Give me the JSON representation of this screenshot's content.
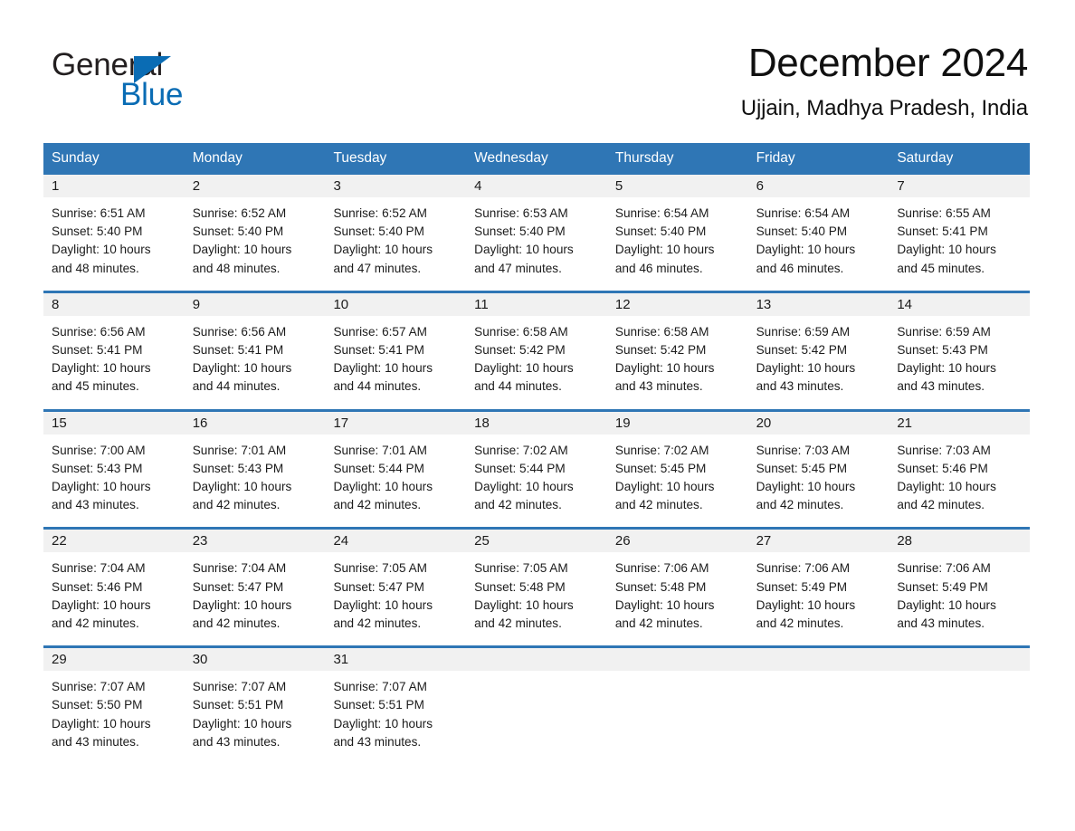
{
  "brand": {
    "word_one": "General",
    "word_two": "Blue",
    "triangle_color": "#0a6cb4"
  },
  "header": {
    "month_title": "December 2024",
    "location_title": "Ujjain, Madhya Pradesh, India"
  },
  "colors": {
    "header_blue": "#2f76b5",
    "day_band_gray": "#f1f1f1",
    "text": "#1b1b1b",
    "page_background": "#ffffff"
  },
  "calendar": {
    "weekdays": [
      "Sunday",
      "Monday",
      "Tuesday",
      "Wednesday",
      "Thursday",
      "Friday",
      "Saturday"
    ],
    "weeks": [
      [
        {
          "day": "1",
          "sunrise": "Sunrise: 6:51 AM",
          "sunset": "Sunset: 5:40 PM",
          "daylight_l1": "Daylight: 10 hours",
          "daylight_l2": "and 48 minutes."
        },
        {
          "day": "2",
          "sunrise": "Sunrise: 6:52 AM",
          "sunset": "Sunset: 5:40 PM",
          "daylight_l1": "Daylight: 10 hours",
          "daylight_l2": "and 48 minutes."
        },
        {
          "day": "3",
          "sunrise": "Sunrise: 6:52 AM",
          "sunset": "Sunset: 5:40 PM",
          "daylight_l1": "Daylight: 10 hours",
          "daylight_l2": "and 47 minutes."
        },
        {
          "day": "4",
          "sunrise": "Sunrise: 6:53 AM",
          "sunset": "Sunset: 5:40 PM",
          "daylight_l1": "Daylight: 10 hours",
          "daylight_l2": "and 47 minutes."
        },
        {
          "day": "5",
          "sunrise": "Sunrise: 6:54 AM",
          "sunset": "Sunset: 5:40 PM",
          "daylight_l1": "Daylight: 10 hours",
          "daylight_l2": "and 46 minutes."
        },
        {
          "day": "6",
          "sunrise": "Sunrise: 6:54 AM",
          "sunset": "Sunset: 5:40 PM",
          "daylight_l1": "Daylight: 10 hours",
          "daylight_l2": "and 46 minutes."
        },
        {
          "day": "7",
          "sunrise": "Sunrise: 6:55 AM",
          "sunset": "Sunset: 5:41 PM",
          "daylight_l1": "Daylight: 10 hours",
          "daylight_l2": "and 45 minutes."
        }
      ],
      [
        {
          "day": "8",
          "sunrise": "Sunrise: 6:56 AM",
          "sunset": "Sunset: 5:41 PM",
          "daylight_l1": "Daylight: 10 hours",
          "daylight_l2": "and 45 minutes."
        },
        {
          "day": "9",
          "sunrise": "Sunrise: 6:56 AM",
          "sunset": "Sunset: 5:41 PM",
          "daylight_l1": "Daylight: 10 hours",
          "daylight_l2": "and 44 minutes."
        },
        {
          "day": "10",
          "sunrise": "Sunrise: 6:57 AM",
          "sunset": "Sunset: 5:41 PM",
          "daylight_l1": "Daylight: 10 hours",
          "daylight_l2": "and 44 minutes."
        },
        {
          "day": "11",
          "sunrise": "Sunrise: 6:58 AM",
          "sunset": "Sunset: 5:42 PM",
          "daylight_l1": "Daylight: 10 hours",
          "daylight_l2": "and 44 minutes."
        },
        {
          "day": "12",
          "sunrise": "Sunrise: 6:58 AM",
          "sunset": "Sunset: 5:42 PM",
          "daylight_l1": "Daylight: 10 hours",
          "daylight_l2": "and 43 minutes."
        },
        {
          "day": "13",
          "sunrise": "Sunrise: 6:59 AM",
          "sunset": "Sunset: 5:42 PM",
          "daylight_l1": "Daylight: 10 hours",
          "daylight_l2": "and 43 minutes."
        },
        {
          "day": "14",
          "sunrise": "Sunrise: 6:59 AM",
          "sunset": "Sunset: 5:43 PM",
          "daylight_l1": "Daylight: 10 hours",
          "daylight_l2": "and 43 minutes."
        }
      ],
      [
        {
          "day": "15",
          "sunrise": "Sunrise: 7:00 AM",
          "sunset": "Sunset: 5:43 PM",
          "daylight_l1": "Daylight: 10 hours",
          "daylight_l2": "and 43 minutes."
        },
        {
          "day": "16",
          "sunrise": "Sunrise: 7:01 AM",
          "sunset": "Sunset: 5:43 PM",
          "daylight_l1": "Daylight: 10 hours",
          "daylight_l2": "and 42 minutes."
        },
        {
          "day": "17",
          "sunrise": "Sunrise: 7:01 AM",
          "sunset": "Sunset: 5:44 PM",
          "daylight_l1": "Daylight: 10 hours",
          "daylight_l2": "and 42 minutes."
        },
        {
          "day": "18",
          "sunrise": "Sunrise: 7:02 AM",
          "sunset": "Sunset: 5:44 PM",
          "daylight_l1": "Daylight: 10 hours",
          "daylight_l2": "and 42 minutes."
        },
        {
          "day": "19",
          "sunrise": "Sunrise: 7:02 AM",
          "sunset": "Sunset: 5:45 PM",
          "daylight_l1": "Daylight: 10 hours",
          "daylight_l2": "and 42 minutes."
        },
        {
          "day": "20",
          "sunrise": "Sunrise: 7:03 AM",
          "sunset": "Sunset: 5:45 PM",
          "daylight_l1": "Daylight: 10 hours",
          "daylight_l2": "and 42 minutes."
        },
        {
          "day": "21",
          "sunrise": "Sunrise: 7:03 AM",
          "sunset": "Sunset: 5:46 PM",
          "daylight_l1": "Daylight: 10 hours",
          "daylight_l2": "and 42 minutes."
        }
      ],
      [
        {
          "day": "22",
          "sunrise": "Sunrise: 7:04 AM",
          "sunset": "Sunset: 5:46 PM",
          "daylight_l1": "Daylight: 10 hours",
          "daylight_l2": "and 42 minutes."
        },
        {
          "day": "23",
          "sunrise": "Sunrise: 7:04 AM",
          "sunset": "Sunset: 5:47 PM",
          "daylight_l1": "Daylight: 10 hours",
          "daylight_l2": "and 42 minutes."
        },
        {
          "day": "24",
          "sunrise": "Sunrise: 7:05 AM",
          "sunset": "Sunset: 5:47 PM",
          "daylight_l1": "Daylight: 10 hours",
          "daylight_l2": "and 42 minutes."
        },
        {
          "day": "25",
          "sunrise": "Sunrise: 7:05 AM",
          "sunset": "Sunset: 5:48 PM",
          "daylight_l1": "Daylight: 10 hours",
          "daylight_l2": "and 42 minutes."
        },
        {
          "day": "26",
          "sunrise": "Sunrise: 7:06 AM",
          "sunset": "Sunset: 5:48 PM",
          "daylight_l1": "Daylight: 10 hours",
          "daylight_l2": "and 42 minutes."
        },
        {
          "day": "27",
          "sunrise": "Sunrise: 7:06 AM",
          "sunset": "Sunset: 5:49 PM",
          "daylight_l1": "Daylight: 10 hours",
          "daylight_l2": "and 42 minutes."
        },
        {
          "day": "28",
          "sunrise": "Sunrise: 7:06 AM",
          "sunset": "Sunset: 5:49 PM",
          "daylight_l1": "Daylight: 10 hours",
          "daylight_l2": "and 43 minutes."
        }
      ],
      [
        {
          "day": "29",
          "sunrise": "Sunrise: 7:07 AM",
          "sunset": "Sunset: 5:50 PM",
          "daylight_l1": "Daylight: 10 hours",
          "daylight_l2": "and 43 minutes."
        },
        {
          "day": "30",
          "sunrise": "Sunrise: 7:07 AM",
          "sunset": "Sunset: 5:51 PM",
          "daylight_l1": "Daylight: 10 hours",
          "daylight_l2": "and 43 minutes."
        },
        {
          "day": "31",
          "sunrise": "Sunrise: 7:07 AM",
          "sunset": "Sunset: 5:51 PM",
          "daylight_l1": "Daylight: 10 hours",
          "daylight_l2": "and 43 minutes."
        },
        {
          "day": "",
          "sunrise": "",
          "sunset": "",
          "daylight_l1": "",
          "daylight_l2": ""
        },
        {
          "day": "",
          "sunrise": "",
          "sunset": "",
          "daylight_l1": "",
          "daylight_l2": ""
        },
        {
          "day": "",
          "sunrise": "",
          "sunset": "",
          "daylight_l1": "",
          "daylight_l2": ""
        },
        {
          "day": "",
          "sunrise": "",
          "sunset": "",
          "daylight_l1": "",
          "daylight_l2": ""
        }
      ]
    ]
  }
}
